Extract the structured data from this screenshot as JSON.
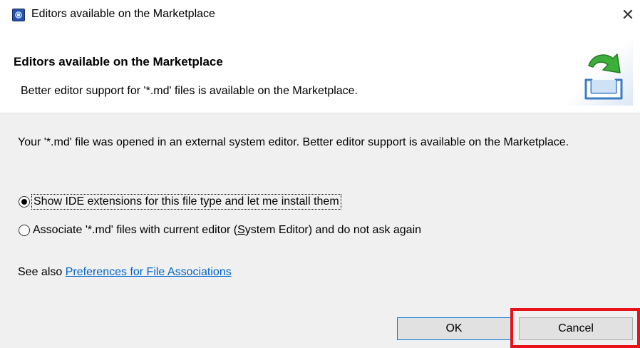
{
  "window": {
    "title": "Editors available on the Marketplace",
    "close_glyph": "✕",
    "icon": "eclipse-app-icon"
  },
  "header": {
    "title": "Editors available on the Marketplace",
    "description": "Better editor support for '*.md' files is available on the Marketplace.",
    "banner_icon": "marketplace-install-icon"
  },
  "content": {
    "message": "Your '*.md' file was opened in an external system editor. Better editor support is available on the Marketplace.",
    "options": [
      {
        "label": "Show IDE extensions for this file type and let me install them",
        "checked": true
      },
      {
        "label_prefix": "Associate '*.md' files with current editor (",
        "label_mnemonic": "S",
        "label_suffix": "ystem Editor) and do not ask again",
        "checked": false
      }
    ],
    "see_also_prefix": "See also ",
    "see_also_link": "Preferences for File Associations"
  },
  "buttons": {
    "ok": "OK",
    "cancel": "Cancel"
  },
  "colors": {
    "highlight": "#e8121a",
    "link": "#0066cc",
    "banner_arrow": "#3cae3a",
    "banner_tray": "#3b7dc4"
  }
}
